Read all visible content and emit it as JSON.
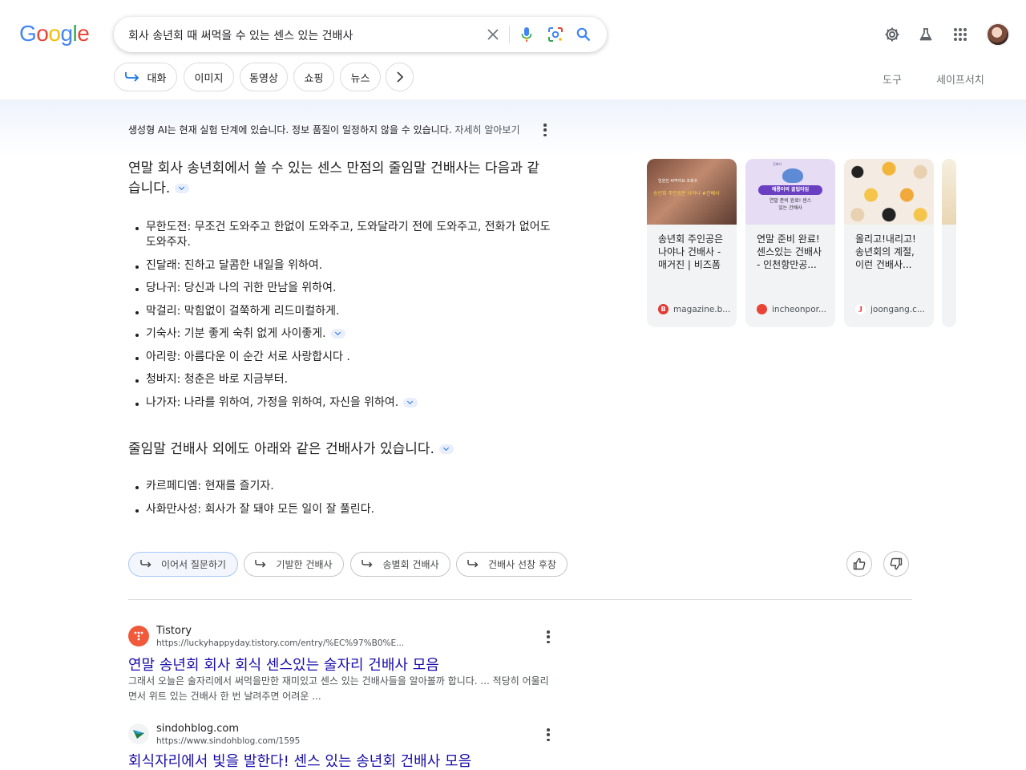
{
  "header": {
    "logo": [
      "G",
      "o",
      "o",
      "g",
      "l",
      "e"
    ],
    "logo_colors": [
      "#4285F4",
      "#EA4335",
      "#FBBC05",
      "#4285F4",
      "#34A853",
      "#EA4335"
    ],
    "search_query": "회사 송년회 때 써먹을 수 있는 센스 있는 건배사"
  },
  "chips": {
    "items": [
      "대화",
      "이미지",
      "동영상",
      "쇼핑",
      "뉴스"
    ],
    "tools": "도구",
    "safesearch": "세이프서치"
  },
  "ai_overview": {
    "notice": "생성형 AI는 현재 실험 단계에 있습니다. 정보 품질이 일정하지 않을 수 있습니다.",
    "notice_link": "자세히 알아보기",
    "heading1": "연말 회사 송년회에서 쓸 수 있는 센스 만점의 줄임말 건배사는 다음과 같습니다.",
    "list1": [
      "무한도전: 무조건 도와주고 한없이 도와주고, 도와달라기 전에 도와주고, 전화가 없어도 도와주자.",
      "진달래: 진하고 달콤한 내일을 위하여.",
      "당나귀: 당신과 나의 귀한 만남을 위하여.",
      "막걸리: 막힘없이 걸쭉하게 리드미컬하게.",
      "기숙사: 기분 좋게 숙취 없게 사이좋게.",
      "아리랑: 아름다운 이 순간 서로 사랑합시다 .",
      "청바지: 청춘은 바로 지금부터.",
      "나가자: 나라를 위하여, 가정을 위하여, 자신을 위하여."
    ],
    "heading2": "줄임말 건배사 외에도 아래와 같은 건배사가 있습니다.",
    "list2": [
      "카르페디엠: 현재를 즐기자.",
      "사화만사성: 회사가 잘 돼야 모든 일이 잘 풀린다."
    ],
    "followups": [
      "이어서 질문하기",
      "기발한 건배사",
      "송별회 건배사",
      "건배사 선창 후창"
    ]
  },
  "cards": [
    {
      "title": "송년회 주인공은 나야나 건배사 - 매거진 | 비즈폼",
      "source": "magazine.b...",
      "fav_letter": "B",
      "fav_color": "#e53935",
      "img_text_top": "임원진 써먹어요 조회수",
      "img_text": "송년회 주인공은 나야나 #건배사"
    },
    {
      "title": "연말 준비 완료! 센스있는 건배사 - 인천항만공...",
      "source": "incheonpor...",
      "fav_letter": "",
      "fav_color": "#ea4335",
      "img_badge": "해룡이의 꿀팁타임",
      "img_text": "연말 준비 완료! 센스있는 건배사",
      "img_small": "건배사"
    },
    {
      "title": "올리고!내리고! 송년회의 계절, 이런 건배사...",
      "source": "joongang.c...",
      "fav_letter": "J",
      "fav_color": "#e53935"
    }
  ],
  "results": [
    {
      "site": "Tistory",
      "url": "https://luckyhappyday.tistory.com/entry/%EC%97%B0%E...",
      "title": "연말 송년회 회사 회식 센스있는 술자리 건배사 모음",
      "snippet": "그래서 오늘은 술자리에서 써먹을만한 재미있고 센스 있는 건배사들을 알아볼까 합니다. ... 적당히 어울리면서 위트 있는 건배사 한 번 날려주면 어려운 ..."
    },
    {
      "site": "sindohblog.com",
      "url": "https://www.sindohblog.com/1595",
      "title": "회식자리에서 빛을 발한다! 센스 있는 송년회 건배사 모음",
      "snippet": ""
    }
  ]
}
